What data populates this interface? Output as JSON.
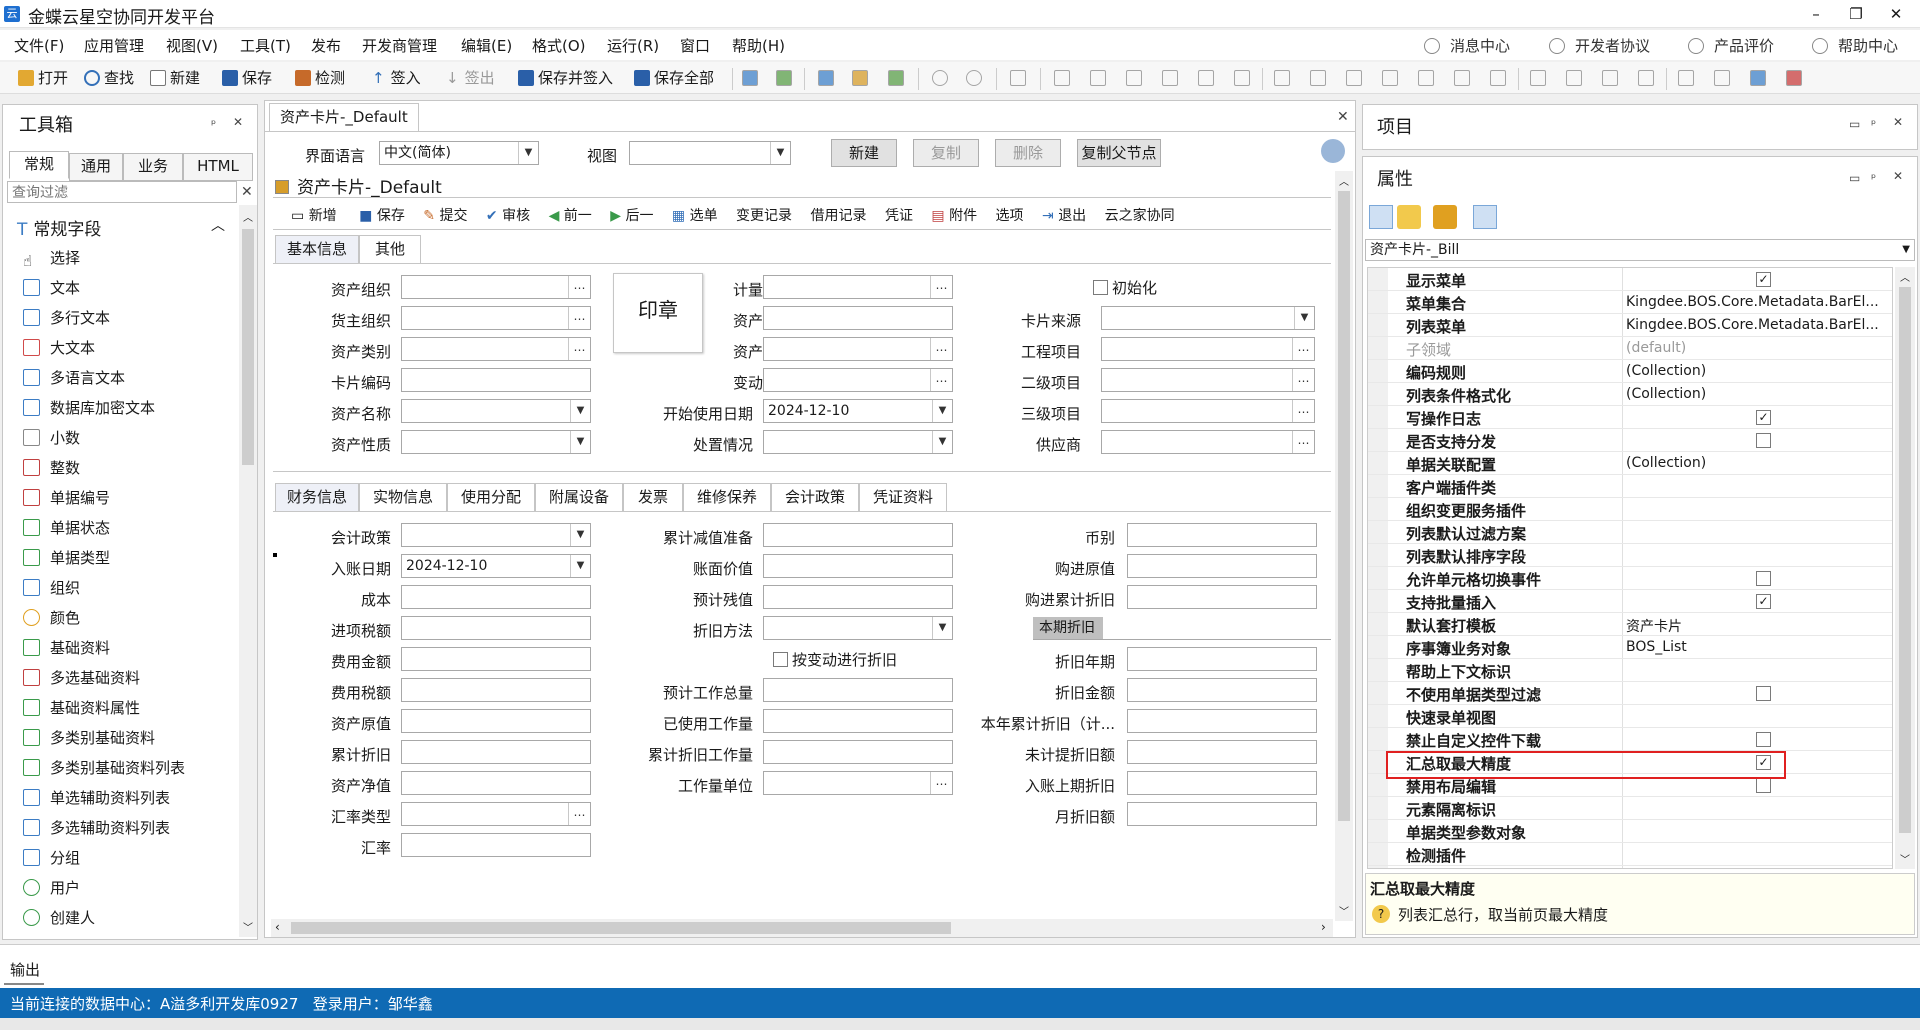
{
  "titlebar": {
    "title": "金蝶云星空协同开发平台",
    "min": "–",
    "restore": "❐",
    "close": "✕"
  },
  "menu": [
    "文件(F)",
    "应用管理",
    "视图(V)",
    "工具(T)",
    "发布",
    "开发商管理",
    "编辑(E)",
    "格式(O)",
    "运行(R)",
    "窗口",
    "帮助(H)"
  ],
  "menu_right": [
    "消息中心",
    "开发者协议",
    "产品评价",
    "帮助中心"
  ],
  "toolbar": {
    "items": [
      "打开",
      "查找",
      "新建",
      "保存",
      "检测",
      "签入",
      "签出",
      "保存并签入",
      "保存全部"
    ]
  },
  "toolbox": {
    "title": "工具箱",
    "tabs": [
      "常规",
      "通用",
      "业务",
      "HTML"
    ],
    "filter_placeholder": "查询过滤",
    "group": "常规字段",
    "items": [
      "选择",
      "文本",
      "多行文本",
      "大文本",
      "多语言文本",
      "数据库加密文本",
      "小数",
      "整数",
      "单据编号",
      "单据状态",
      "单据类型",
      "组织",
      "颜色",
      "基础资料",
      "多选基础资料",
      "基础资料属性",
      "多类别基础资料",
      "多类别基础资料列表",
      "单选辅助资料列表",
      "多选辅助资料列表",
      "分组",
      "用户",
      "创建人"
    ]
  },
  "doc": {
    "tab": "资产卡片-_Default",
    "lang_label": "界面语言",
    "lang_value": "中文(简体)",
    "view_label": "视图",
    "btn_new": "新建",
    "btn_copy": "复制",
    "btn_delete": "删除",
    "btn_copy_parent": "复制父节点",
    "form_title": "资产卡片-_Default",
    "form_tools": [
      "新增",
      "保存",
      "提交",
      "审核",
      "前一",
      "后一",
      "选单",
      "变更记录",
      "借用记录",
      "凭证",
      "附件",
      "选项",
      "退出",
      "云之家协同"
    ],
    "top_tabs": [
      "基本信息",
      "其他"
    ],
    "stamp": "印章",
    "top_col1": [
      "资产组织",
      "货主组织",
      "资产类别",
      "卡片编码",
      "资产名称",
      "资产性质"
    ],
    "top_col2": [
      "计量单位",
      "资产数量",
      "资产状态",
      "变动方式",
      "开始使用日期",
      "处置情况"
    ],
    "start_date": "2024-12-10",
    "init_label": "初始化",
    "top_col3": [
      "卡片来源",
      "工程项目",
      "二级项目",
      "三级项目",
      "供应商"
    ],
    "bottom_tabs": [
      "财务信息",
      "实物信息",
      "使用分配",
      "附属设备",
      "发票",
      "维修保养",
      "会计政策",
      "凭证资料"
    ],
    "fin_col1": [
      "会计政策",
      "入账日期",
      "成本",
      "进项税额",
      "费用金额",
      "费用税额",
      "资产原值",
      "累计折旧",
      "资产净值",
      "汇率类型",
      "汇率"
    ],
    "entry_date": "2024-12-10",
    "fin_col2": [
      "累计减值准备",
      "账面价值",
      "预计残值",
      "折旧方法"
    ],
    "by_change_label": "按变动进行折旧",
    "fin_col2b": [
      "预计工作总量",
      "已使用工作量",
      "累计折旧工作量",
      "工作量单位"
    ],
    "fin_col3": [
      "币别",
      "购进原值",
      "购进累计折旧"
    ],
    "current_depr": "本期折旧",
    "fin_col3b": [
      "折旧年期",
      "折旧金额",
      "本年累计折旧（计...",
      "未计提折旧额",
      "入账上期折旧",
      "月折旧额"
    ]
  },
  "project": {
    "title": "项目"
  },
  "props": {
    "title": "属性",
    "selector": "资产卡片-_Bill",
    "rows": [
      {
        "name": "显示菜单",
        "value": "",
        "check": true
      },
      {
        "name": "菜单集合",
        "value": "Kingdee.BOS.Core.Metadata.BarEl..."
      },
      {
        "name": "列表菜单",
        "value": "Kingdee.BOS.Core.Metadata.BarEl..."
      },
      {
        "name": "子领域",
        "value": "(default)",
        "dim": true
      },
      {
        "name": "编码规则",
        "value": "(Collection)"
      },
      {
        "name": "列表条件格式化",
        "value": "(Collection)"
      },
      {
        "name": "写操作日志",
        "value": "",
        "check": true
      },
      {
        "name": "是否支持分发",
        "value": "",
        "check": false
      },
      {
        "name": "单据关联配置",
        "value": "(Collection)"
      },
      {
        "name": "客户端插件类",
        "value": ""
      },
      {
        "name": "组织变更服务插件",
        "value": ""
      },
      {
        "name": "列表默认过滤方案",
        "value": ""
      },
      {
        "name": "列表默认排序字段",
        "value": ""
      },
      {
        "name": "允许单元格切换事件",
        "value": "",
        "check": false
      },
      {
        "name": "支持批量插入",
        "value": "",
        "check": true
      },
      {
        "name": "默认套打模板",
        "value": "资产卡片"
      },
      {
        "name": "序事簿业务对象",
        "value": "BOS_List"
      },
      {
        "name": "帮助上下文标识",
        "value": ""
      },
      {
        "name": "不使用单据类型过滤",
        "value": "",
        "check": false
      },
      {
        "name": "快速录单视图",
        "value": ""
      },
      {
        "name": "禁止自定义控件下载",
        "value": "",
        "check": false
      },
      {
        "name": "汇总取最大精度",
        "value": "",
        "check": true
      },
      {
        "name": "禁用布局编辑",
        "value": "",
        "check": false
      },
      {
        "name": "元素隔离标识",
        "value": ""
      },
      {
        "name": "单据类型参数对象",
        "value": ""
      },
      {
        "name": "检测插件",
        "value": ""
      }
    ],
    "desc_title": "汇总取最大精度",
    "desc_text": "列表汇总行，取当前页最大精度"
  },
  "output": {
    "label": "输出"
  },
  "status": {
    "text": "当前连接的数据中心：A溢多利开发库0927   登录用户：邹华鑫"
  },
  "colors": {
    "status_bg": "#0f6ab4",
    "highlight": "#e02020"
  }
}
